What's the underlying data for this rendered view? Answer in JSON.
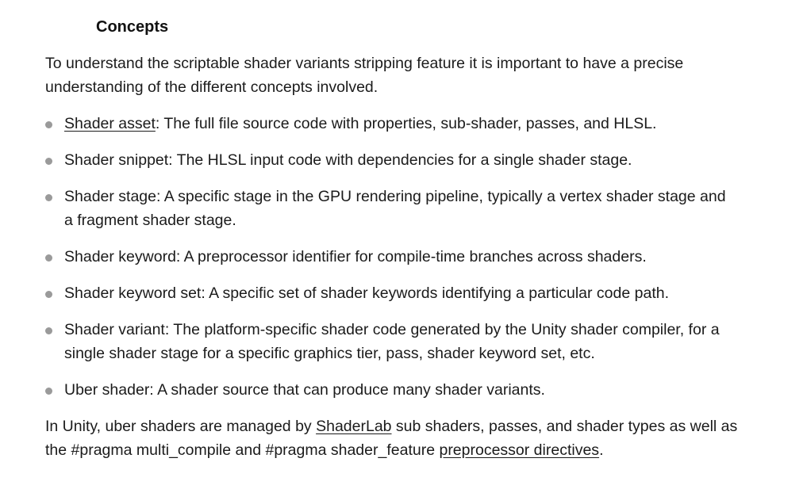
{
  "heading": "Concepts",
  "intro": "To understand the scriptable shader variants stripping feature it is important to have a precise understanding of the different concepts involved.",
  "items": [
    {
      "link": "Shader asset",
      "text": ": The full file source code with properties, sub-shader, passes, and HLSL."
    },
    {
      "text": "Shader snippet: The HLSL input code with dependencies for a single shader stage."
    },
    {
      "text": "Shader stage: A specific stage in the GPU rendering pipeline, typically a vertex shader stage and a fragment shader stage."
    },
    {
      "text": "Shader keyword: A preprocessor identifier for compile-time branches across shaders."
    },
    {
      "text": "Shader keyword set: A specific set of shader keywords identifying a particular code path."
    },
    {
      "text": "Shader variant: The platform-specific shader code generated by the Unity shader compiler, for a single shader stage for a specific graphics tier, pass, shader keyword set, etc."
    },
    {
      "text": "Uber shader: A shader source that can produce many shader variants."
    }
  ],
  "outro": {
    "part1": "In Unity, uber shaders are managed by ",
    "link1": "ShaderLab",
    "part2": " sub shaders, passes, and shader types as well as the #pragma multi_compile and #pragma shader_feature ",
    "link2": "preprocessor directives",
    "part3": "."
  }
}
